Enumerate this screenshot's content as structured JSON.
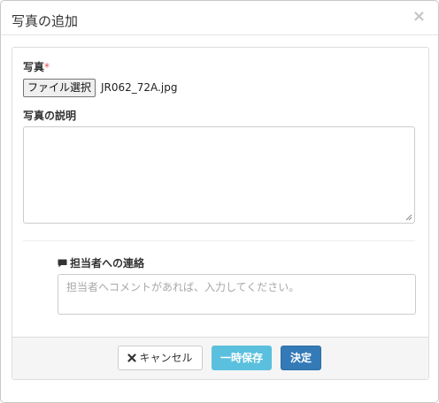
{
  "dialog": {
    "title": "写真の追加",
    "close_symbol": "×"
  },
  "photo": {
    "label": "写真",
    "required_mark": "*",
    "file_button_label": "ファイル選択",
    "file_name": "JR062_72A.jpg"
  },
  "description": {
    "label": "写真の説明",
    "value": ""
  },
  "contact": {
    "label": "担当者への連絡",
    "placeholder": "担当者へコメントがあれば、入力してください。",
    "value": ""
  },
  "footer": {
    "cancel_label": "キャンセル",
    "temp_save_label": "一時保存",
    "confirm_label": "決定"
  },
  "colors": {
    "primary": "#337ab7",
    "info": "#5bc0de",
    "required": "#d9534f"
  },
  "icons": {
    "close": "close-icon",
    "comment": "comment-icon",
    "cancel": "x-icon",
    "resize": "resize-grip-icon"
  }
}
